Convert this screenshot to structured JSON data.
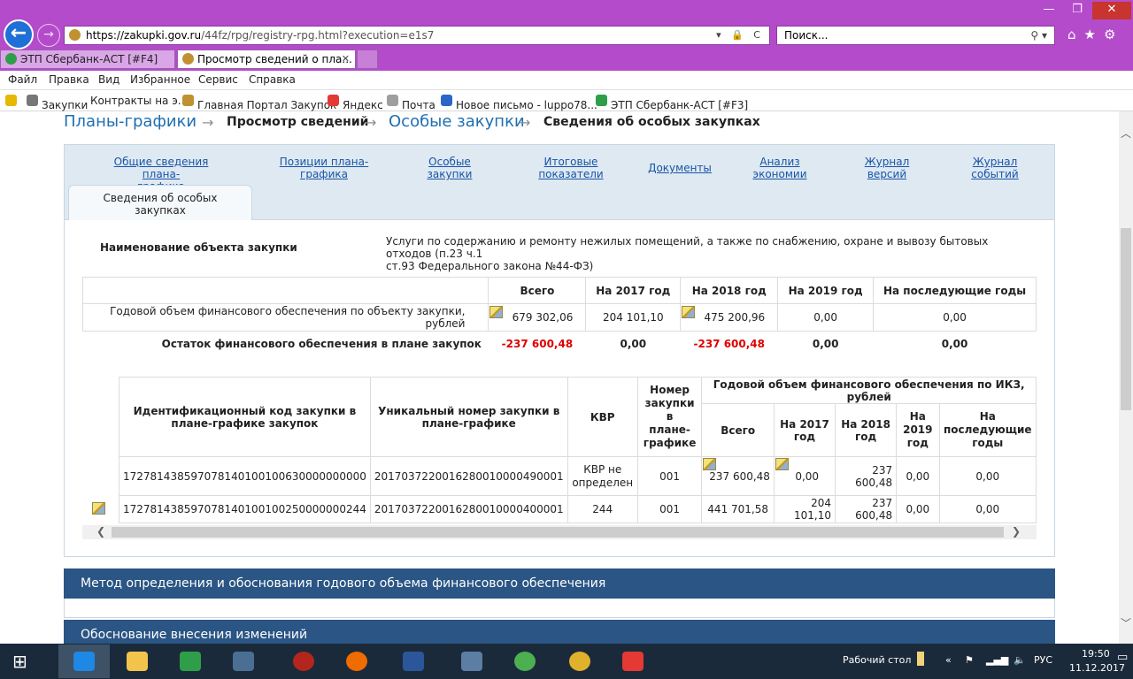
{
  "browser": {
    "url_host": "https://zakupki.gov.ru",
    "url_path": "/44fz/rpg/registry-rpg.html?execution=e1s7",
    "search_placeholder": "Поиск...",
    "tabs": [
      {
        "label": "ЭТП Сбербанк-АСТ [#F4]"
      },
      {
        "label": "Просмотр сведений о пла..."
      }
    ],
    "menu": [
      "Файл",
      "Правка",
      "Вид",
      "Избранное",
      "Сервис",
      "Справка"
    ],
    "favorites": [
      "Закупки",
      "Контракты на э...",
      "Главная Портал Закупок",
      "Яндекс",
      "Почта",
      "Новое письмо - luppo78...",
      "ЭТП Сбербанк-АСТ [#F3]"
    ],
    "colors": {
      "frame": "#b44bcb",
      "back_button": "#1e6fd6"
    }
  },
  "breadcrumb": {
    "item1": "Планы-графики",
    "item2": "Просмотр сведений",
    "item3": "Особые закупки",
    "item4": "Сведения об особых закупках",
    "separator": "→"
  },
  "page_tabs": {
    "general": [
      "Общие сведения плана-",
      "графика"
    ],
    "positions": [
      "Позиции плана-",
      "графика"
    ],
    "special": [
      "Особые",
      "закупки"
    ],
    "totals": [
      "Итоговые",
      "показатели"
    ],
    "documents": "Документы",
    "analysis": [
      "Анализ",
      "экономии"
    ],
    "versions": [
      "Журнал",
      "версий"
    ],
    "events": [
      "Журнал",
      "событий"
    ],
    "active": [
      "Сведения об особых",
      "закупках"
    ]
  },
  "object": {
    "label": "Наименование объекта закупки",
    "value_line1": "Услуги по содержанию и ремонту нежилых помещений, а также по снабжению, охране и вывозу бытовых отходов (п.23 ч.1",
    "value_line2": "ст.93 Федерального закона №44-ФЗ)"
  },
  "volume_table": {
    "headers": [
      "Всего",
      "На 2017 год",
      "На 2018 год",
      "На 2019 год",
      "На последующие годы"
    ],
    "row_label": "Годовой объем финансового обеспечения по объекту закупки, рублей",
    "row_values": [
      "679 302,06",
      "204 101,10",
      "475 200,96",
      "0,00",
      "0,00"
    ],
    "remainder_label": "Остаток финансового обеспечения в плане закупок",
    "remainder_values": [
      "-237 600,48",
      "0,00",
      "-237 600,48",
      "0,00",
      "0,00"
    ]
  },
  "ikz_table": {
    "h_code": "Идентификационный код закупки в плане-графике закупок",
    "h_unique": "Уникальный номер закупки в плане-графике",
    "h_kvr": "КВР",
    "h_num": [
      "Номер",
      "закупки",
      "в",
      "плане-",
      "графике"
    ],
    "h_group": "Годовой объем финансового обеспечения по ИКЗ, рублей",
    "h_total": "Всего",
    "h_2017": [
      "На 2017",
      "год"
    ],
    "h_2018": [
      "На 2018",
      "год"
    ],
    "h_2019": [
      "На",
      "2019",
      "год"
    ],
    "h_next": [
      "На",
      "последующие",
      "годы"
    ],
    "rows": [
      {
        "code": "172781438597078140100100630000000000",
        "unique": "201703722001628001000049000​1",
        "kvr": [
          "КВР не",
          "определен"
        ],
        "num": "001",
        "total": "237 600,48",
        "y2017": "0,00",
        "y2018": "237 600,48",
        "y2019": "0,00",
        "next": "0,00"
      },
      {
        "code": "172781438597078140100100250000000244",
        "unique": "2017037220016280010000400001",
        "kvr": [
          "244",
          ""
        ],
        "num": "001",
        "total": "441 701,58",
        "y2017": "204 101,10",
        "y2018": "237 600,48",
        "y2019": "0,00",
        "next": "0,00"
      }
    ]
  },
  "sections": {
    "method": "Метод определения и обоснования годового объема финансового обеспечения",
    "changes": "Обоснование внесения изменений"
  },
  "taskbar": {
    "desktop_label": "Рабочий стол",
    "language": "РУС",
    "time": "19:50",
    "date": "11.12.2017"
  }
}
